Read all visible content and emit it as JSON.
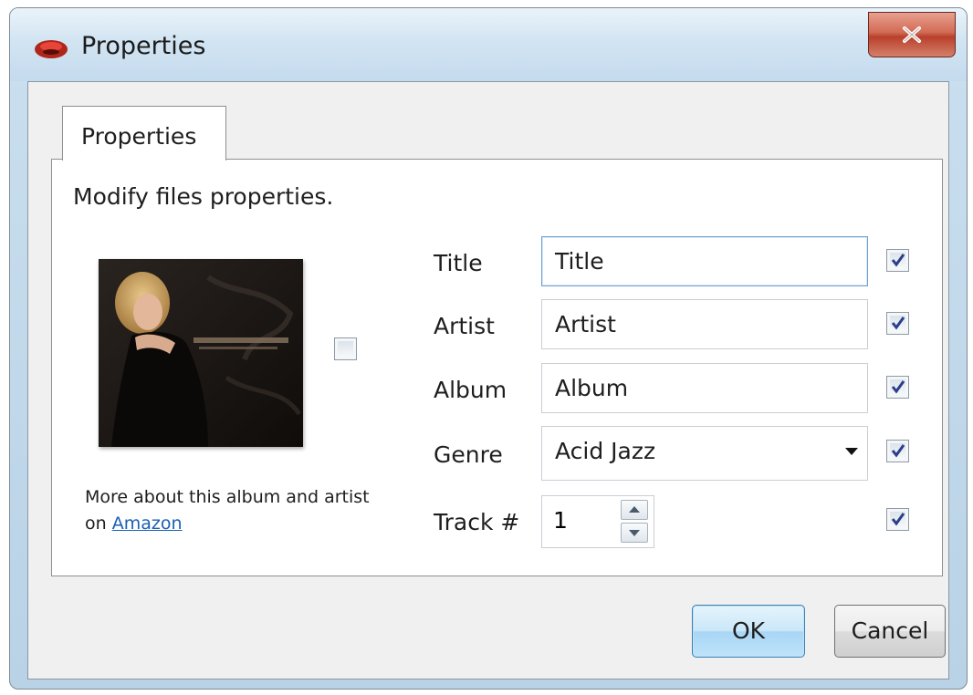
{
  "window": {
    "title": "Properties",
    "close_label": "X"
  },
  "tabs": [
    {
      "label": "Properties",
      "selected": true
    }
  ],
  "panel": {
    "description": "Modify files properties.",
    "cover_checkbox_checked": false,
    "amazon_prefix": "More about this album and artist",
    "amazon_on": "on",
    "amazon_link": "Amazon"
  },
  "fields": {
    "title": {
      "label": "Title",
      "value": "Title",
      "checked": true
    },
    "artist": {
      "label": "Artist",
      "value": "Artist",
      "checked": true
    },
    "album": {
      "label": "Album",
      "value": "Album",
      "checked": true
    },
    "genre": {
      "label": "Genre",
      "value": "Acid Jazz",
      "checked": true
    },
    "track": {
      "label": "Track #",
      "value": "1",
      "checked": true
    }
  },
  "buttons": {
    "ok": "OK",
    "cancel": "Cancel"
  },
  "colors": {
    "link": "#1a5fb4",
    "ok_border": "#3c7fb1",
    "close_red": "#c44a33"
  }
}
